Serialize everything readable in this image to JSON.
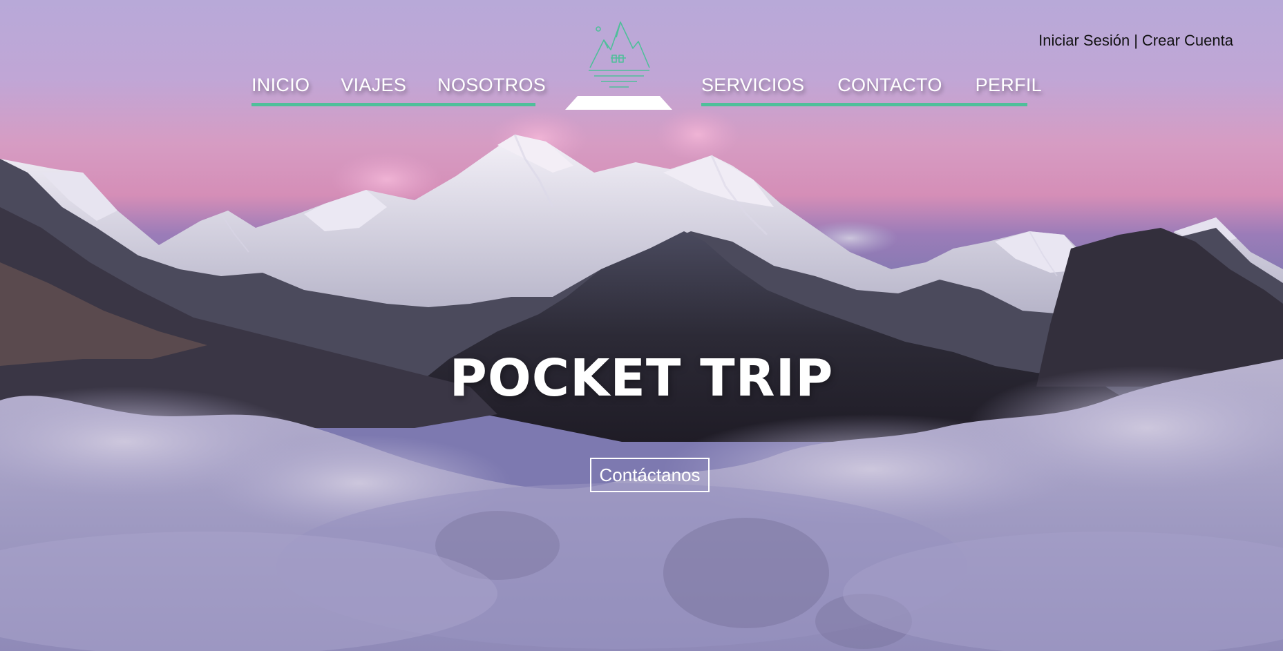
{
  "header": {
    "auth": {
      "login": "Iniciar Sesión",
      "separator": "|",
      "register": "Crear Cuenta"
    },
    "nav_left": [
      {
        "label": "INICIO"
      },
      {
        "label": "VIAJES"
      },
      {
        "label": "NOSOTROS"
      }
    ],
    "nav_right": [
      {
        "label": "SERVICIOS"
      },
      {
        "label": "CONTACTO"
      },
      {
        "label": "PERFIL"
      }
    ],
    "logo_icon": "mountain-logo-icon"
  },
  "hero": {
    "title": "POCKET TRIP",
    "cta_label": "Contáctanos",
    "background": "mountain-sunset-photo"
  },
  "colors": {
    "accent": "#4fbf9a",
    "text_light": "#ffffff",
    "text_dark": "#111111",
    "sky_top": "#b7a8d6",
    "sky_pink": "#d98fb4"
  }
}
